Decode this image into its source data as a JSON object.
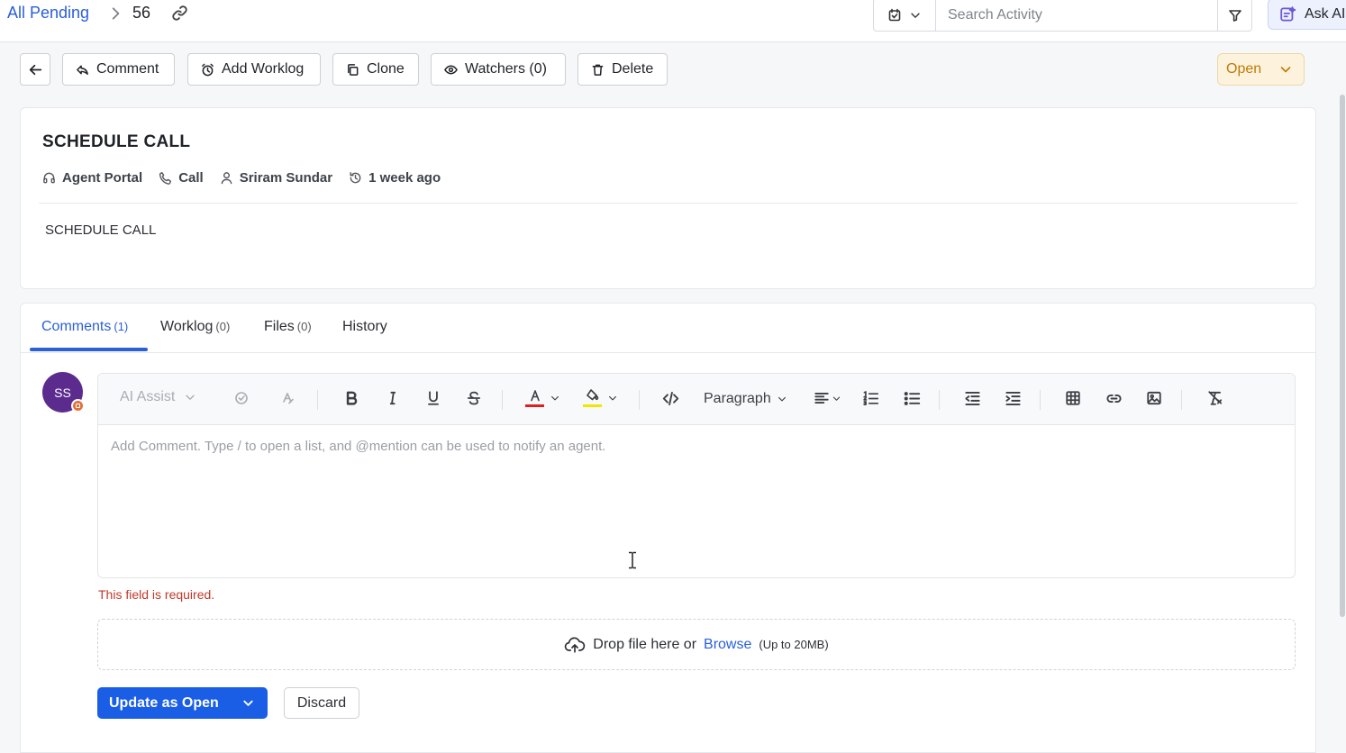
{
  "breadcrumb": {
    "parent": "All Pending",
    "separator": ">",
    "current": "56"
  },
  "search": {
    "placeholder": "Search Activity",
    "value": ""
  },
  "ask_ai": {
    "label": "Ask AI"
  },
  "actions": {
    "comment": "Comment",
    "add_worklog": "Add Worklog",
    "clone": "Clone",
    "watchers": "Watchers (0)",
    "delete": "Delete"
  },
  "status": {
    "label": "Open",
    "color": "#c07a05"
  },
  "ticket": {
    "title": "SCHEDULE CALL",
    "source": "Agent Portal",
    "type": "Call",
    "requester": "Sriram Sundar",
    "time": "1 week ago",
    "description": "SCHEDULE CALL"
  },
  "tabs": [
    {
      "label": "Comments",
      "count": "(1)",
      "active": true
    },
    {
      "label": "Worklog",
      "count": "(0)",
      "active": false
    },
    {
      "label": "Files",
      "count": "(0)",
      "active": false
    },
    {
      "label": "History",
      "count": "",
      "active": false
    }
  ],
  "avatar": {
    "initials": "SS",
    "color": "#5b2c8e"
  },
  "editor": {
    "ai_assist": "AI Assist",
    "block_format": "Paragraph",
    "placeholder": "Add Comment. Type / to open a list, and @mention can be used to notify an agent.",
    "icons": [
      "spell-check-icon",
      "clear-ai-icon",
      "bold-icon",
      "italic-icon",
      "underline-icon",
      "strikethrough-icon",
      "text-color-icon",
      "highlight-color-icon",
      "code-icon",
      "align-icon",
      "ordered-list-icon",
      "bullet-list-icon",
      "outdent-icon",
      "indent-icon",
      "table-icon",
      "link-icon",
      "image-icon",
      "clear-format-icon"
    ],
    "text_color": "#e02020",
    "highlight_color": "#f2e600"
  },
  "validation": {
    "error": "This field is required."
  },
  "upload": {
    "text": "Drop file here or",
    "browse": "Browse",
    "limit": "(Up to 20MB)"
  },
  "footer": {
    "submit": "Update as Open",
    "discard": "Discard",
    "submit_color": "#1a5ee6"
  }
}
